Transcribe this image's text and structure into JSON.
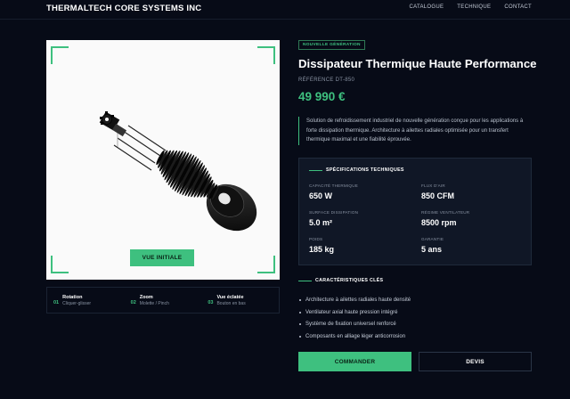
{
  "header": {
    "brand": "THERMALTECH CORE SYSTEMS INC",
    "nav": [
      "CATALOGUE",
      "TECHNIQUE",
      "CONTACT"
    ]
  },
  "viewer": {
    "reset_label": "VUE INITIALE",
    "controls": [
      {
        "num": "01",
        "title": "Rotation",
        "sub": "Cliquer-glisser"
      },
      {
        "num": "02",
        "title": "Zoom",
        "sub": "Molette / Pinch"
      },
      {
        "num": "03",
        "title": "Vue éclatée",
        "sub": "Bouton en bas"
      }
    ]
  },
  "product": {
    "badge": "NOUVELLE GÉNÉRATION",
    "title": "Dissipateur Thermique Haute Performance",
    "reference": "RÉFÉRENCE DT-850",
    "price": "49 990 €",
    "description": "Solution de refroidissement industriel de nouvelle génération conçue pour les applications à forte dissipation thermique. Architecture à ailettes radiales optimisée pour un transfert thermique maximal et une fiabilité éprouvée."
  },
  "specs": {
    "heading": "SPÉCIFICATIONS TECHNIQUES",
    "items": [
      {
        "label": "CAPACITÉ THERMIQUE",
        "value": "650 W"
      },
      {
        "label": "FLUX D'AIR",
        "value": "850 CFM"
      },
      {
        "label": "SURFACE DISSIPATION",
        "value": "5.0 m²"
      },
      {
        "label": "RÉGIME VENTILATEUR",
        "value": "8500 rpm"
      },
      {
        "label": "POIDS",
        "value": "185 kg"
      },
      {
        "label": "GARANTIE",
        "value": "5 ans"
      }
    ]
  },
  "features": {
    "heading": "CARACTÉRISTIQUES CLÉS",
    "items": [
      "Architecture à ailettes radiales haute densité",
      "Ventilateur axial haute pression intégré",
      "Système de fixation universel renforcé",
      "Composants en alliage léger anticorrosion"
    ]
  },
  "actions": {
    "order": "COMMANDER",
    "quote": "DEVIS"
  },
  "colors": {
    "accent": "#3ec07f",
    "background": "#070b17",
    "panel": "#101726"
  }
}
